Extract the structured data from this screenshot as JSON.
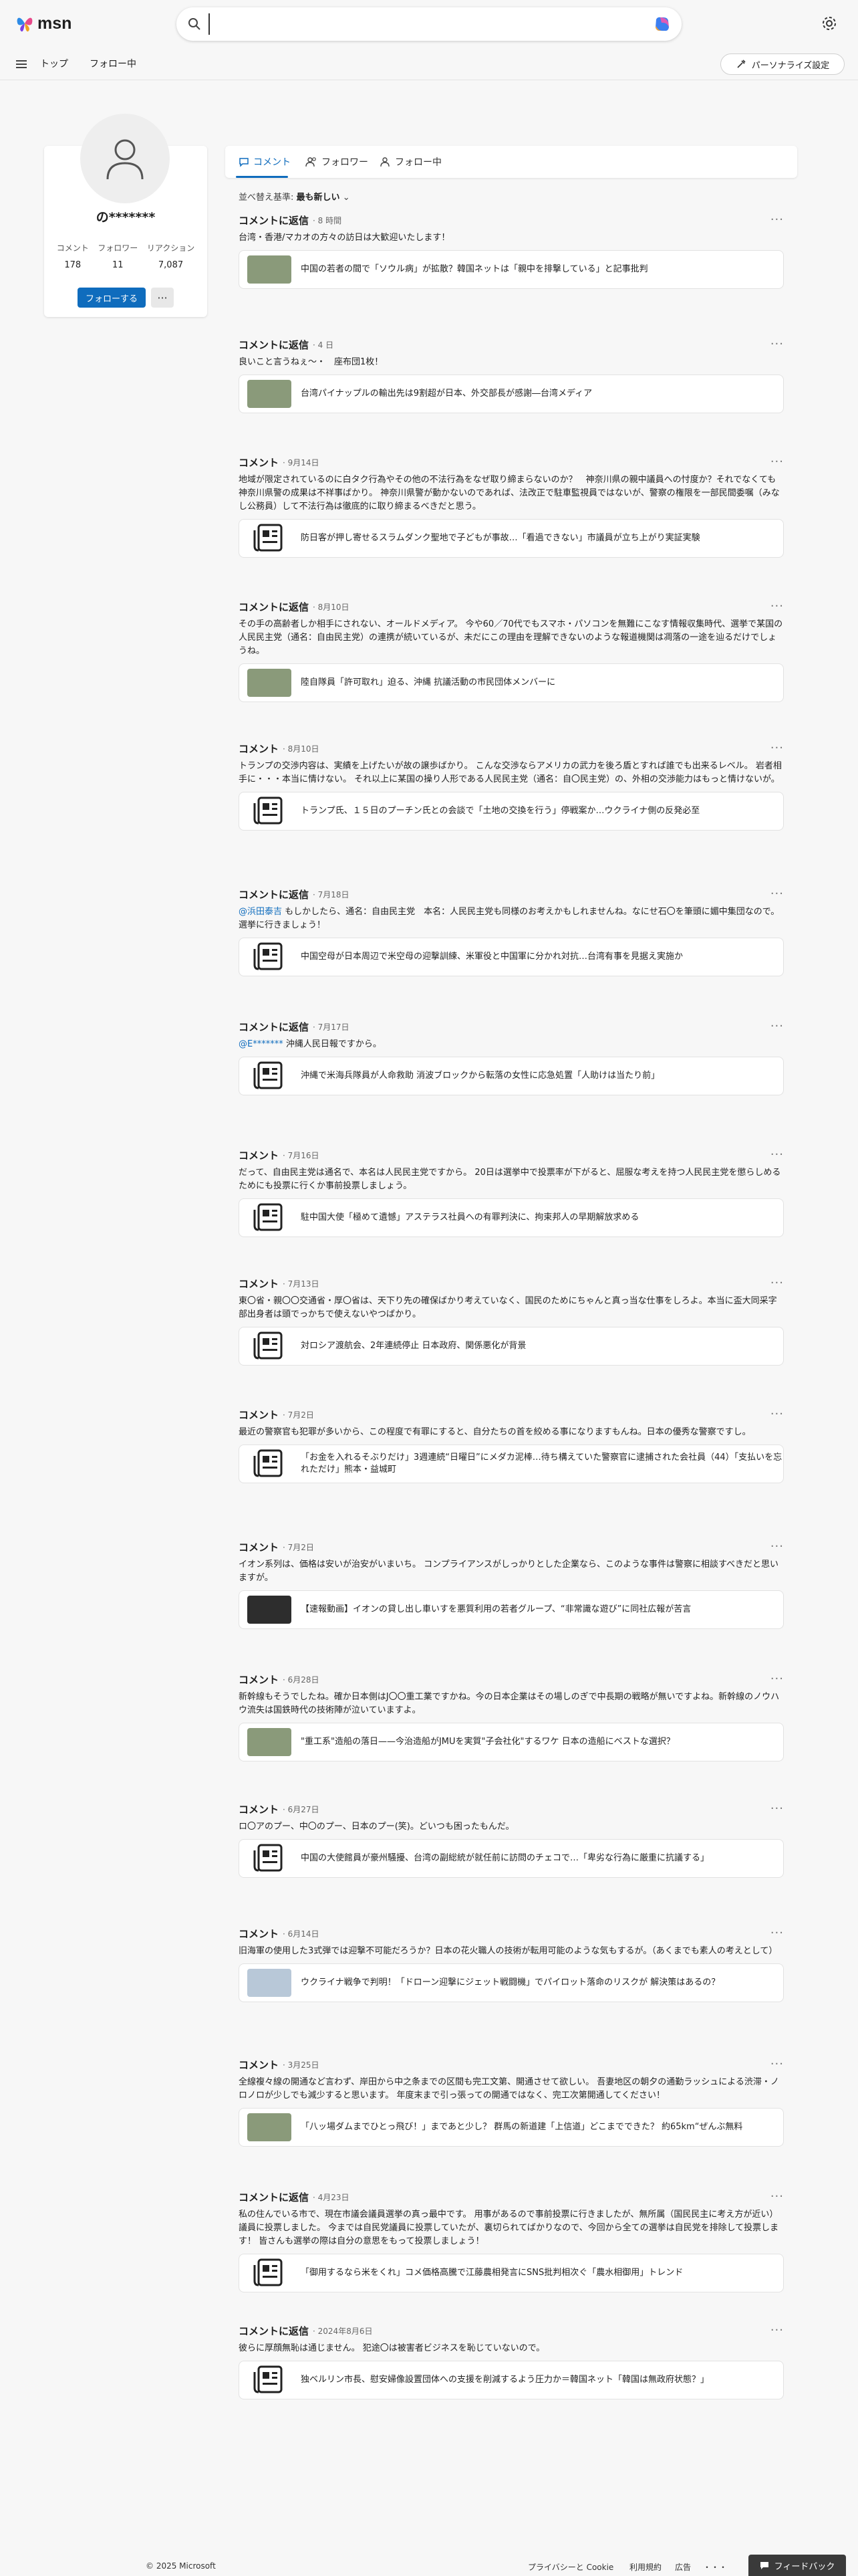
{
  "header": {
    "brand": "msn",
    "search_value": "",
    "nav": [
      "トップ",
      "フォロー中"
    ],
    "personalize_label": "パーソナライズ設定"
  },
  "profile": {
    "name": "の*******",
    "stats": [
      {
        "label": "コメント",
        "value": "178"
      },
      {
        "label": "フォロワー",
        "value": "11"
      },
      {
        "label": "リアクション",
        "value": "7,087"
      }
    ],
    "follow_label": "フォローする",
    "more_label": "···"
  },
  "tabs": [
    {
      "label": "コメント",
      "icon": "comment-icon"
    },
    {
      "label": "フォロワー",
      "icon": "followers-icon"
    },
    {
      "label": "フォロー中",
      "icon": "following-icon"
    }
  ],
  "sort": {
    "label": "並べ替え基準:",
    "value": "最も新しい"
  },
  "items": [
    {
      "title": "コメントに返信",
      "time": "8 時間",
      "mention": "",
      "text": "台湾・香港/マカオの方々の訪日は大歓迎いたします！",
      "card_title": "中国の若者の間で「ソウル病」が拡散？韓国ネットは「親中を排撃している」と記事批判",
      "thumb": "photo"
    },
    {
      "title": "コメントに返信",
      "time": "4 日",
      "mention": "",
      "text": "良いこと言うねぇ〜・　座布団1枚！",
      "card_title": "台湾パイナップルの輸出先は9割超が日本、外交部長が感謝―台湾メディア",
      "thumb": "photo"
    },
    {
      "title": "コメント",
      "time": "9月14日",
      "mention": "",
      "text": "地域が限定されているのに白タク行為やその他の不法行為をなぜ取り締まらないのか？　神奈川県の親中議員への忖度か？それでなくても神奈川県警の成果は不祥事ばかり。 神奈川県警が動かないのであれば、法改正で駐車監視員ではないが、警察の権限を一部民間委嘱（みなし公務員）して不法行為は徹底的に取り締まるべきだと思う。",
      "card_title": "防日客が押し寄せるスラムダンク聖地で子どもが事故…「看過できない」市議員が立ち上がり実証実験",
      "thumb": "icon"
    },
    {
      "title": "コメントに返信",
      "time": "8月10日",
      "mention": "",
      "text": "その手の高齢者しか相手にされない、オールドメディア。 今や60／70代でもスマホ・パソコンを無難にこなす情報収集時代、選挙で某国の人民民主党（通名：自由民主党）の連携が続いているが、未だにこの理由を理解できないのような報道機関は凋落の一途を辿るだけでしょうね。",
      "card_title": "陸自隊員「許可取れ」迫る、沖縄 抗議活動の市民団体メンバーに",
      "thumb": "photo"
    },
    {
      "title": "コメント",
      "time": "8月10日",
      "mention": "",
      "text": "トランプの交渉内容は、実績を上げたいが故の譲歩ばかり。 こんな交渉ならアメリカの武力を後ろ盾とすれば誰でも出来るレベル。 岩者相手に・・・本当に情けない。 それ以上に某国の操り人形である人民民主党（通名：自〇民主党）の、外相の交渉能力はもっと情けないが。",
      "card_title": "トランプ氏、１５日のプーチン氏との会談で「土地の交換を行う」停戦案か…ウクライナ側の反発必至",
      "thumb": "icon"
    },
    {
      "title": "コメントに返信",
      "time": "7月18日",
      "mention": "@浜田泰吉",
      "text": " もしかしたら、通名：自由民主党　本名：人民民主党も同様のお考えかもしれませんね。なにせ石〇を筆頭に媚中集団なので。 選挙に行きましょう！",
      "card_title": "中国空母が日本周辺で米空母の迎撃訓練、米軍役と中国軍に分かれ対抗…台湾有事を見据え実施か",
      "thumb": "icon"
    },
    {
      "title": "コメントに返信",
      "time": "7月17日",
      "mention": "@E*******",
      "text": " 沖縄人民日報ですから。",
      "card_title": "沖縄で米海兵隊員が人命救助 消波ブロックから転落の女性に応急処置「人助けは当たり前」",
      "thumb": "icon"
    },
    {
      "title": "コメント",
      "time": "7月16日",
      "mention": "",
      "text": "だって、自由民主党は通名で、本名は人民民主党ですから。 20日は選挙中で投票率が下がると、屈服な考えを持つ人民民主党を懲らしめるためにも投票に行くか事前投票しましょう。",
      "card_title": "駐中国大使「極めて遺憾」アステラス社員への有罪判決に、拘束邦人の早期解放求める",
      "thumb": "icon"
    },
    {
      "title": "コメント",
      "time": "7月13日",
      "mention": "",
      "text": "東〇省・親〇〇交通省・厚〇省は、天下り先の確保ばかり考えていなく、国民のためにちゃんと真っ当な仕事をしろよ。本当に盃大同采字部出身者は頭でっかちで使えないやつばかり。",
      "card_title": "対ロシア渡航会、2年連続停止 日本政府、関係悪化が背景",
      "thumb": "icon"
    },
    {
      "title": "コメント",
      "time": "7月2日",
      "mention": "",
      "text": "最近の警察官も犯罪が多いから、この程度で有罪にすると、自分たちの首を絞める事になりますもんね。日本の優秀な警察ですし。",
      "card_title": "「お金を入れるそぶりだけ」3週連続“日曜日”にメダカ泥棒…待ち構えていた警察官に逮捕された会社員（44）「支払いを忘れただけ」熊本・益城町",
      "thumb": "icon"
    },
    {
      "title": "コメント",
      "time": "7月2日",
      "mention": "",
      "text": "イオン系列は、価格は安いが治安がいまいち。 コンプライアンスがしっかりとした企業なら、このような事件は警察に相談すべきだと思いますが。",
      "card_title": "【速報動画】イオンの貸し出し車いすを悪質利用の若者グループ、“非常識な遊び”に同社広報が苦言",
      "thumb": "photo-dark"
    },
    {
      "title": "コメント",
      "time": "6月28日",
      "mention": "",
      "text": "新幹線もそうでしたね。確か日本側はJ〇〇重工業ですかね。今の日本企業はその場しのぎで中長期の戦略が無いですよね。新幹線のノウハウ流失は国鉄時代の技術陣が泣いていますよ。",
      "card_title": "\"重工系\"造船の落日——今治造船がJMUを実質\"子会社化\"するワケ 日本の造船にベストな選択？",
      "thumb": "photo"
    },
    {
      "title": "コメント",
      "time": "6月27日",
      "mention": "",
      "text": "ロ〇アのプー、中〇のプー、日本のプー(笑)。どいつも困ったもんだ。",
      "card_title": "中国の大使館員が豪州騒擾、台湾の副総統が就任前に訪問のチェコで…「卑劣な行為に厳重に抗議する」",
      "thumb": "icon"
    },
    {
      "title": "コメント",
      "time": "6月14日",
      "mention": "",
      "text": "旧海軍の使用した3式弾では迎撃不可能だろうか？日本の花火職人の技術が転用可能のような気もするが。（あくまでも素人の考えとして）",
      "card_title": "ウクライナ戦争で判明！「ドローン迎撃にジェット戦闘機」でパイロット落命のリスクが 解決策はあるの？",
      "thumb": "photo-sky"
    },
    {
      "title": "コメント",
      "time": "3月25日",
      "mention": "",
      "text": "全線複々線の開通など言わず、岸田から中之条までの区間も完工文第、開通させて欲しい。 吾妻地区の朝夕の通勤ラッシュによる渋滞・ノロノロが少しでも減少すると思います。 年度末まで引っ張っての開通ではなく、完工次第開通してください！",
      "card_title": "「八ッ場ダムまでひとっ飛び！」まであと少し？ 群馬の新道建「上信道」どこまでできた？ 約65km“ぜんぶ無料",
      "thumb": "photo"
    },
    {
      "title": "コメントに返信",
      "time": "4月23日",
      "mention": "",
      "text": "私の住んでいる市で、現在市議会議員選挙の真っ最中です。 用事があるので事前投票に行きましたが、無所属（国民民主に考え方が近い）議員に投票しました。 今までは自民党議員に投票していたが、裏切られてばかりなので、今回から全ての選挙は自民党を排除して投票します！ 皆さんも選挙の際は自分の意思をもって投票しましょう！",
      "card_title": "「御用するなら米をくれ」コメ価格高騰で江藤農相発言にSNS批判相次ぐ「農水相御用」トレンド",
      "thumb": "icon"
    },
    {
      "title": "コメントに返信",
      "time": "2024年8月6日",
      "mention": "",
      "text": "彼らに厚顔無恥は通じません。 犯途〇は被害者ビジネスを恥じていないので。",
      "card_title": "独ベルリン市長、慰安婦像設置団体への支援を削減するよう圧力か＝韓国ネット「韓国は無政府状態？」",
      "thumb": "icon"
    }
  ],
  "footer": {
    "copyright": "© 2025 Microsoft",
    "links": [
      "プライバシーと Cookie",
      "利用規約",
      "広告",
      "・・・"
    ],
    "feedback_label": "フィードバック"
  },
  "colors": {
    "accent": "#0f6cbd",
    "background": "#f7f7f7"
  }
}
